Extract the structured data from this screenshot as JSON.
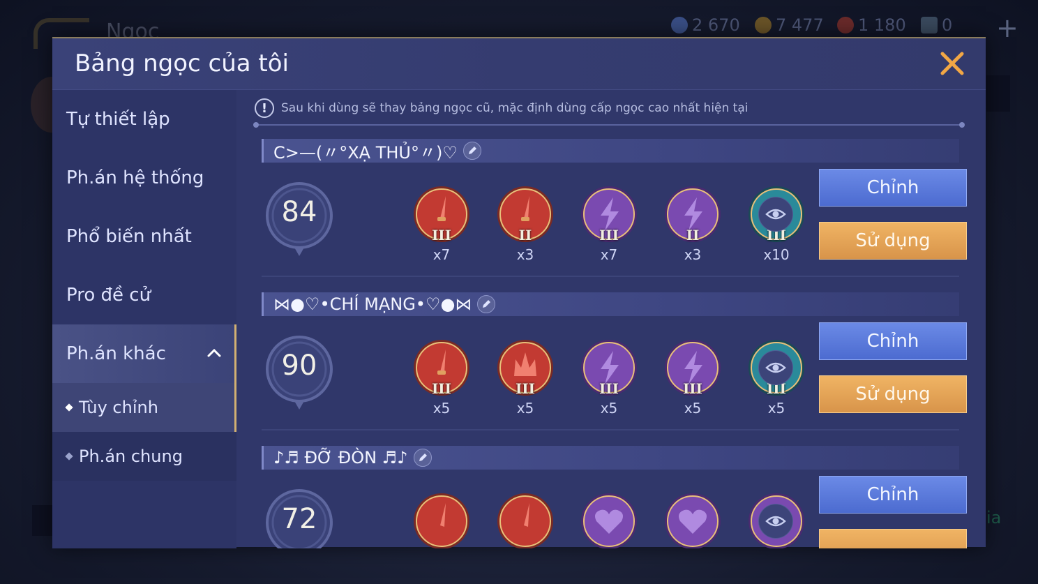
{
  "background": {
    "title": "Ngọc",
    "currencies": [
      {
        "icon": "blue-gem-icon",
        "value": "2 670",
        "color": "#4a6cc0"
      },
      {
        "icon": "gold-coin-icon",
        "value": "7 477",
        "color": "#c89a3a"
      },
      {
        "icon": "red-voucher-icon",
        "value": "1 180",
        "color": "#c0443c"
      },
      {
        "icon": "card-icon",
        "value": "0",
        "color": "#6a88a8"
      }
    ],
    "right_text": "ia"
  },
  "modal": {
    "title": "Bảng ngọc của tôi",
    "notice": "Sau khi dùng sẽ thay bảng ngọc cũ, mặc định dùng cấp ngọc cao nhất hiện tại"
  },
  "sidebar": {
    "items": [
      {
        "label": "Tự thiết lập"
      },
      {
        "label": "Ph.án hệ thống"
      },
      {
        "label": "Phổ biến nhất"
      },
      {
        "label": "Pro đề cử"
      },
      {
        "label": "Ph.án khác"
      }
    ],
    "sub_items": [
      {
        "label": "Tùy chỉnh"
      },
      {
        "label": "Ph.án chung"
      }
    ]
  },
  "sets": [
    {
      "name": "C>—(〃°XẠ THỦ°〃)♡",
      "level": "84",
      "edit_label": "Chỉnh",
      "use_label": "Sử dụng",
      "gems": [
        {
          "type": "red-sword",
          "tier": "III",
          "count": "x7"
        },
        {
          "type": "red-sword",
          "tier": "II",
          "count": "x3"
        },
        {
          "type": "purple-lightning",
          "tier": "III",
          "count": "x7"
        },
        {
          "type": "purple-lightning",
          "tier": "II",
          "count": "x3"
        },
        {
          "type": "teal-boot",
          "tier": "III",
          "count": "x10"
        }
      ]
    },
    {
      "name": "⋈●♡•CHÍ MẠNG•♡●⋈",
      "level": "90",
      "edit_label": "Chỉnh",
      "use_label": "Sử dụng",
      "gems": [
        {
          "type": "red-sword",
          "tier": "III",
          "count": "x5"
        },
        {
          "type": "red-crown",
          "tier": "III",
          "count": "x5"
        },
        {
          "type": "purple-lightning",
          "tier": "III",
          "count": "x5"
        },
        {
          "type": "purple-lightning",
          "tier": "III",
          "count": "x5"
        },
        {
          "type": "teal-boot",
          "tier": "III",
          "count": "x5"
        }
      ]
    },
    {
      "name": "♪♬ ĐỠ ĐÒN ♬♪",
      "level": "72",
      "edit_label": "Chỉnh",
      "use_label": "",
      "gems": [
        {
          "type": "red-sword",
          "tier": "",
          "count": ""
        },
        {
          "type": "red-sword",
          "tier": "",
          "count": ""
        },
        {
          "type": "purple-heart",
          "tier": "",
          "count": ""
        },
        {
          "type": "purple-heart",
          "tier": "",
          "count": ""
        },
        {
          "type": "purple-heart",
          "tier": "",
          "count": ""
        }
      ]
    }
  ]
}
